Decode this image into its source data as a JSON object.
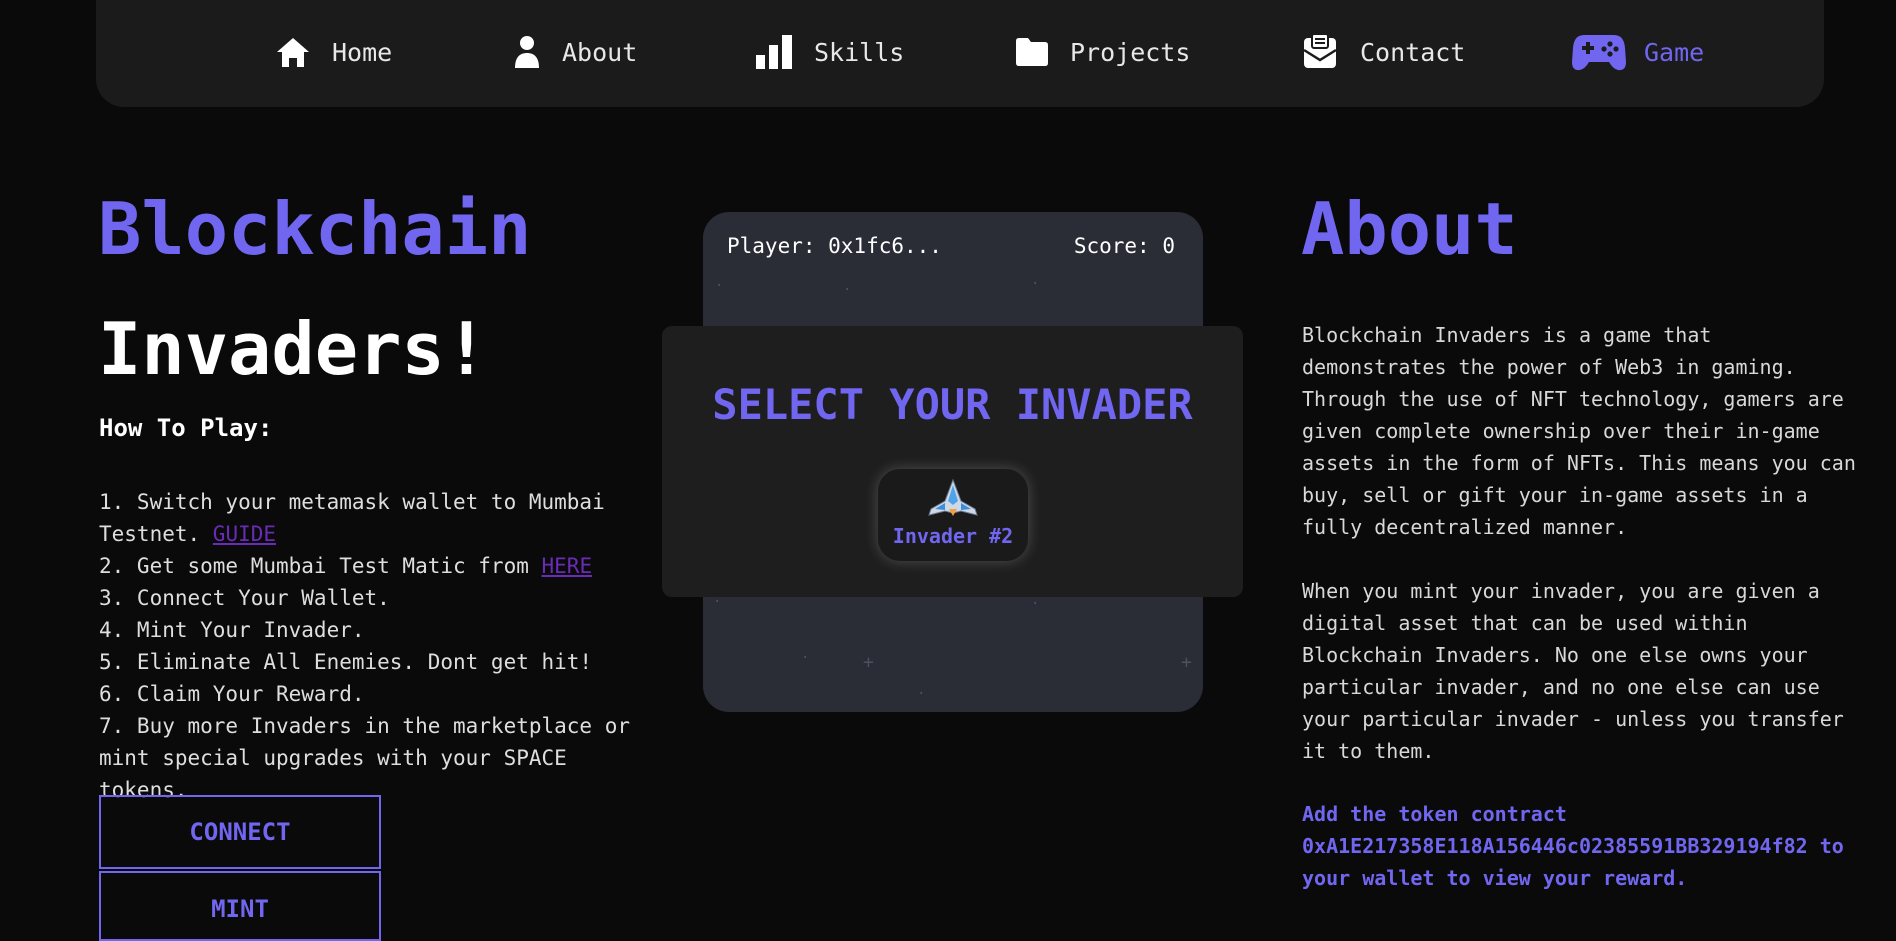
{
  "nav": {
    "items": [
      {
        "label": "Home",
        "icon": "home-icon"
      },
      {
        "label": "About",
        "icon": "person-icon"
      },
      {
        "label": "Skills",
        "icon": "bar-chart-icon"
      },
      {
        "label": "Projects",
        "icon": "folder-icon"
      },
      {
        "label": "Contact",
        "icon": "contact-card-icon"
      },
      {
        "label": "Game",
        "icon": "gamepad-icon",
        "active": true
      }
    ]
  },
  "hero": {
    "title_line1": "Blockchain",
    "title_line2": "Invaders!",
    "howto_heading": "How To Play:",
    "steps": [
      {
        "text": "1. Switch your metamask wallet to Mumbai Testnet. ",
        "link": "GUIDE"
      },
      {
        "text": "2. Get some Mumbai Test Matic from ",
        "link": "HERE"
      },
      {
        "text": "3. Connect Your Wallet."
      },
      {
        "text": "4. Mint Your Invader."
      },
      {
        "text": "5. Eliminate All Enemies. Dont get hit!"
      },
      {
        "text": "6. Claim Your Reward."
      },
      {
        "text": "7. Buy more Invaders in the marketplace or mint special upgrades with your SPACE tokens."
      }
    ],
    "buttons": {
      "connect": "CONNECT",
      "mint": "MINT"
    }
  },
  "game": {
    "player": "Player: 0x1fc6...",
    "score": "Score: 0",
    "modal_title": "SELECT YOUR INVADER",
    "invader_label": "Invader #2",
    "invader_icon": "spaceship-icon"
  },
  "about": {
    "title": "About",
    "paragraph1": "Blockchain Invaders is a game that demonstrates the power of Web3 in gaming. Through the use of NFT technology, gamers are given complete ownership over their in-game assets in the form of NFTs. This means you can buy, sell or gift your in-game assets in a fully decentralized manner.",
    "paragraph2": "When you mint your invader, you are given a digital asset that can be used within Blockchain Invaders. No one else owns your particular invader, and no one else can use your particular invader - unless you transfer it to them.",
    "token_note": "Add the token contract 0xA1E217358E118A156446c02385591BB329194f82 to your wallet to view your reward."
  },
  "colors": {
    "accent": "#7166f0",
    "link": "#6a2bb7",
    "background": "#0a0a0a",
    "nav_bg": "#1b1b1b",
    "game_bg": "#2a2d35"
  }
}
